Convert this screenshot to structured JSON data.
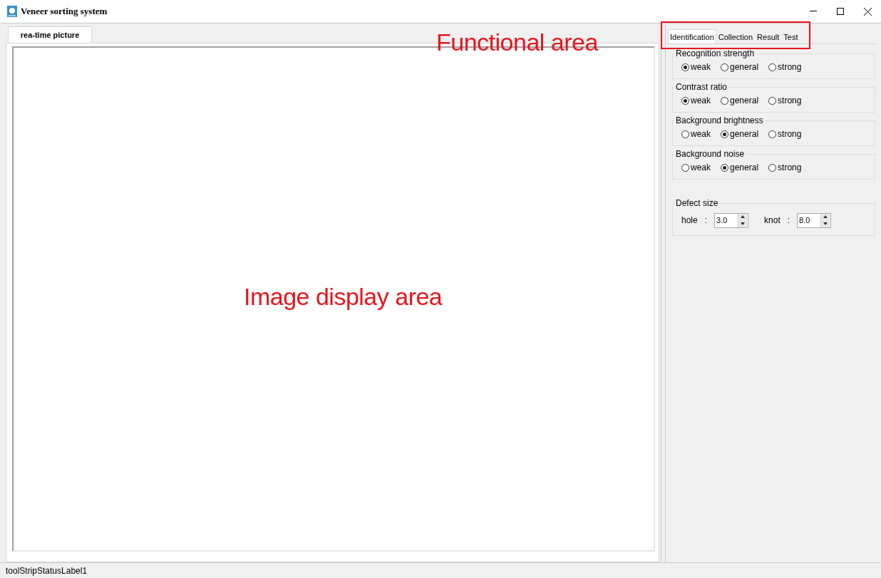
{
  "window": {
    "title": "Veneer sorting system"
  },
  "image_tab": {
    "label": "rea-time picture",
    "selected": true
  },
  "function_tabs": [
    {
      "label": "Identification",
      "selected": true
    },
    {
      "label": "Collection",
      "selected": false
    },
    {
      "label": "Result",
      "selected": false
    },
    {
      "label": "Test",
      "selected": false
    }
  ],
  "groups": [
    {
      "title": "Recognition strength",
      "options": [
        {
          "label": "weak",
          "selected": true
        },
        {
          "label": "general",
          "selected": false
        },
        {
          "label": "strong",
          "selected": false
        }
      ]
    },
    {
      "title": "Contrast ratio",
      "options": [
        {
          "label": "weak",
          "selected": true
        },
        {
          "label": "general",
          "selected": false
        },
        {
          "label": "strong",
          "selected": false
        }
      ]
    },
    {
      "title": "Background brightness",
      "options": [
        {
          "label": "weak",
          "selected": false
        },
        {
          "label": "general",
          "selected": true
        },
        {
          "label": "strong",
          "selected": false
        }
      ]
    },
    {
      "title": "Background noise",
      "options": [
        {
          "label": "weak",
          "selected": false
        },
        {
          "label": "general",
          "selected": true
        },
        {
          "label": "strong",
          "selected": false
        }
      ]
    }
  ],
  "defect_size": {
    "title": "Defect size",
    "fields": [
      {
        "label": "hole",
        "separator": ":",
        "value": "3.0"
      },
      {
        "label": "knot",
        "separator": ":",
        "value": "8.0"
      }
    ]
  },
  "annotations": [
    {
      "kind": "label",
      "text": "Functional area"
    },
    {
      "kind": "label",
      "text": "Image display area"
    }
  ],
  "status_bar": {
    "text": "toolStripStatusLabel1"
  }
}
